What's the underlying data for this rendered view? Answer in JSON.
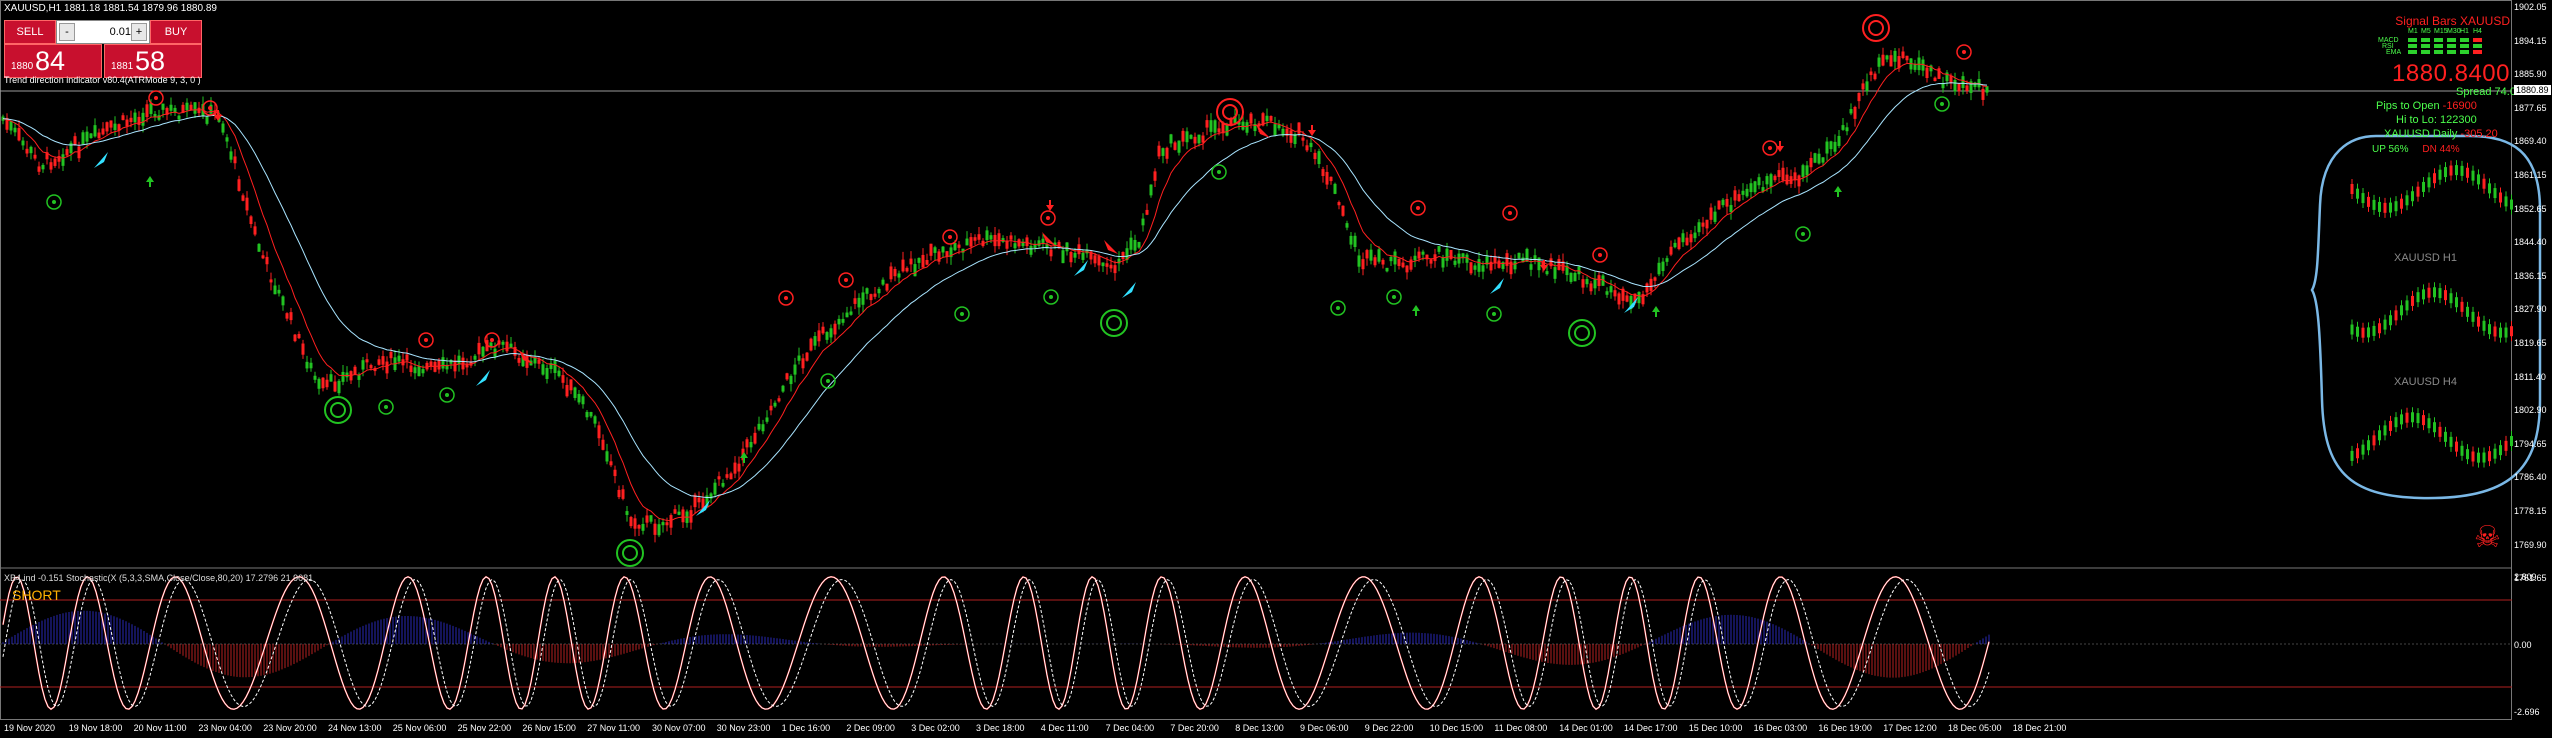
{
  "symbol_header": "XAUUSD,H1  1881.18 1881.54 1879.96 1880.89",
  "trade_panel": {
    "sell_label": "SELL",
    "buy_label": "BUY",
    "lot_value": "0.01",
    "minus": "-",
    "plus": "+",
    "sell_small": "1880",
    "sell_big": "84",
    "buy_small": "1881",
    "buy_big": "58"
  },
  "indicator_label": "Trend direction indicator v80.4(ATRMode 9, 3, 0 )",
  "subwindow_label": "XB4 ind -0.151   Stochastic(X (5,3,3,SMA,Close/Close,80,20) 17.2796 21.9081",
  "short_label": "SHORT",
  "signal_panel": {
    "title": "Signal Bars XAUUSD",
    "timeframes": [
      "M1",
      "M5",
      "M15",
      "M30",
      "H1",
      "H4"
    ],
    "rows": [
      "MACD",
      "RSI",
      "EMA"
    ],
    "price": "1880.8400",
    "spread_label": "Spread",
    "spread_value": "74.0",
    "pips_label": "Pips to Open",
    "pips_value": "-16900",
    "hilo_label": "Hi to Lo:",
    "hilo_value": "122300",
    "daily_label": "XAUUSD Daily",
    "daily_value": "-305.20",
    "up_pct": "UP 56%",
    "dn_pct": "DN 44%"
  },
  "mini_charts": [
    "XAUUSD H1",
    "XAUUSD H4"
  ],
  "price_axis": [
    "1902.05",
    "1894.15",
    "1885.90",
    "1877.65",
    "1869.40",
    "1861.15",
    "1852.65",
    "1844.40",
    "1836.15",
    "1827.90",
    "1819.65",
    "1811.40",
    "1802.90",
    "1794.65",
    "1786.40",
    "1778.15",
    "1769.90",
    "1761.65"
  ],
  "current_price_tag": "1880.89",
  "sub_axis": [
    "2.809",
    "0.00",
    "-2.696"
  ],
  "time_axis": [
    "19 Nov 2020",
    "19 Nov 18:00",
    "20 Nov 11:00",
    "23 Nov 04:00",
    "23 Nov 20:00",
    "24 Nov 13:00",
    "25 Nov 06:00",
    "25 Nov 22:00",
    "26 Nov 15:00",
    "27 Nov 11:00",
    "30 Nov 07:00",
    "30 Nov 23:00",
    "1 Dec 16:00",
    "2 Dec 09:00",
    "3 Dec 02:00",
    "3 Dec 18:00",
    "4 Dec 11:00",
    "7 Dec 04:00",
    "7 Dec 20:00",
    "8 Dec 13:00",
    "9 Dec 06:00",
    "9 Dec 22:00",
    "10 Dec 15:00",
    "11 Dec 08:00",
    "14 Dec 01:00",
    "14 Dec 17:00",
    "15 Dec 10:00",
    "16 Dec 03:00",
    "16 Dec 19:00",
    "17 Dec 12:00",
    "18 Dec 05:00",
    "18 Dec 21:00"
  ],
  "colors": {
    "bull": "#22c322",
    "bear": "#ff2020",
    "ma_fast": "#ff2020",
    "ma_slow": "#a8e4ff",
    "stoch_main": "#ffffff",
    "stoch_signal": "#ffffff",
    "hist_pos": "#3a3aff",
    "hist_neg": "#ff3030",
    "bracket": "#7ab8e6"
  }
}
